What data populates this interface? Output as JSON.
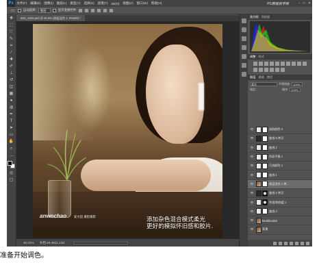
{
  "app": {
    "logo": "Ps",
    "brand": "PS教程自学网",
    "window_controls": [
      "−",
      "□",
      "✕"
    ]
  },
  "menu": [
    "文件(F)",
    "编辑(E)",
    "图像(I)",
    "图层(L)",
    "类型(Y)",
    "选择(S)",
    "滤镜(T)",
    "3D(D)",
    "视图(V)",
    "窗口(W)",
    "帮助(H)"
  ],
  "options": {
    "auto_select": "自动选择:",
    "target": "图层",
    "show_transform": "显示变换控件"
  },
  "document": {
    "tab_title": "IMG_4325.psd @ 45.3% (图层混色 1, RGB/8) *"
  },
  "photo": {
    "watermark": "anwnchao",
    "watermark_sub": "安文超 摄影摄影",
    "caption_line1": "添加杂色混合模式柔光",
    "caption_line2": "更好的模拟怀旧感和胶片."
  },
  "status": {
    "zoom": "45.31%",
    "doc": "文档:49.4M/1.13G"
  },
  "panels": {
    "top_tabs": [
      "直方图",
      "导航器"
    ],
    "adj_tabs": [
      "调整",
      "样式"
    ],
    "layer_tabs": [
      "图层",
      "通道",
      "路径"
    ],
    "blend_mode": "柔光",
    "opacity_label": "不透明度:",
    "opacity": "100%",
    "fill_label": "填充:",
    "fill": "100%",
    "lock_label": "锁定:"
  },
  "layers": [
    {
      "name": "选取颜色 2",
      "thumb": "light",
      "mask": "white",
      "selected": false
    },
    {
      "name": "曲线 5 拷贝",
      "thumb": "dark",
      "mask": "white",
      "selected": false
    },
    {
      "name": "曲线 2",
      "thumb": "light",
      "mask": "white",
      "selected": false
    },
    {
      "name": "色彩平衡 1",
      "thumb": "light",
      "mask": "white",
      "selected": false
    },
    {
      "name": "可选颜色 1",
      "thumb": "light",
      "mask": "white",
      "selected": false
    },
    {
      "name": "曲线 1",
      "thumb": "light",
      "mask": "white",
      "selected": false
    },
    {
      "name": "图层混色 1 拷...",
      "thumb": "img",
      "mask": "white",
      "selected": true
    },
    {
      "name": "曲线 2 拷贝",
      "thumb": "dark",
      "mask": "blk",
      "selected": false
    },
    {
      "name": "色相/饱和度 1",
      "thumb": "light",
      "mask": "blk",
      "selected": false
    },
    {
      "name": "曲线 2",
      "thumb": "light",
      "mask": "white",
      "selected": false
    },
    {
      "name": "Modification",
      "thumb": "img",
      "mask": "",
      "selected": false
    },
    {
      "name": "背景",
      "thumb": "img",
      "mask": "",
      "selected": false
    }
  ],
  "page_caption": "准备开始调色。",
  "colors": {
    "accent": "#31a8ff",
    "ui_bg": "#535353"
  }
}
